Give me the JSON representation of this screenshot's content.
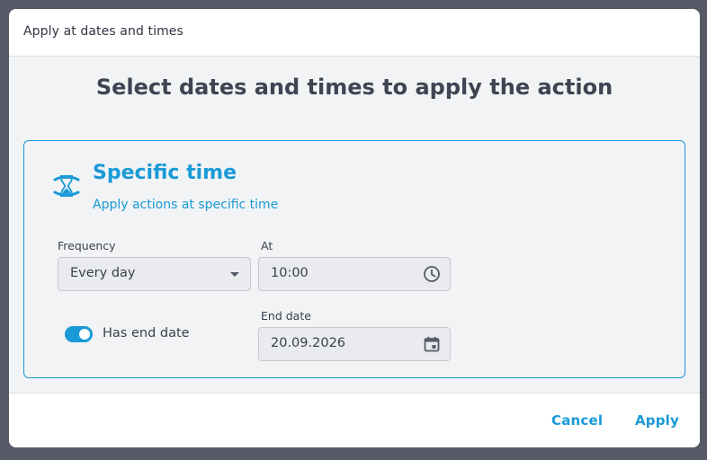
{
  "dialog": {
    "title": "Apply at dates and times",
    "heading": "Select dates and times to apply the action"
  },
  "card": {
    "icon": "hourglass-icon",
    "title": "Specific time",
    "subtitle": "Apply actions at specific time",
    "frequency": {
      "label": "Frequency",
      "value": "Every day"
    },
    "at": {
      "label": "At",
      "value": "10:00",
      "icon": "clock-icon"
    },
    "end_date_toggle": {
      "label": "Has end date",
      "checked": true
    },
    "end_date": {
      "label": "End date",
      "value": "20.09.2026",
      "icon": "calendar-icon"
    }
  },
  "footer": {
    "cancel_label": "Cancel",
    "apply_label": "Apply"
  },
  "colors": {
    "accent": "#1a9ad6",
    "backdrop": "#555a66",
    "body_bg": "#f1f3f5"
  }
}
